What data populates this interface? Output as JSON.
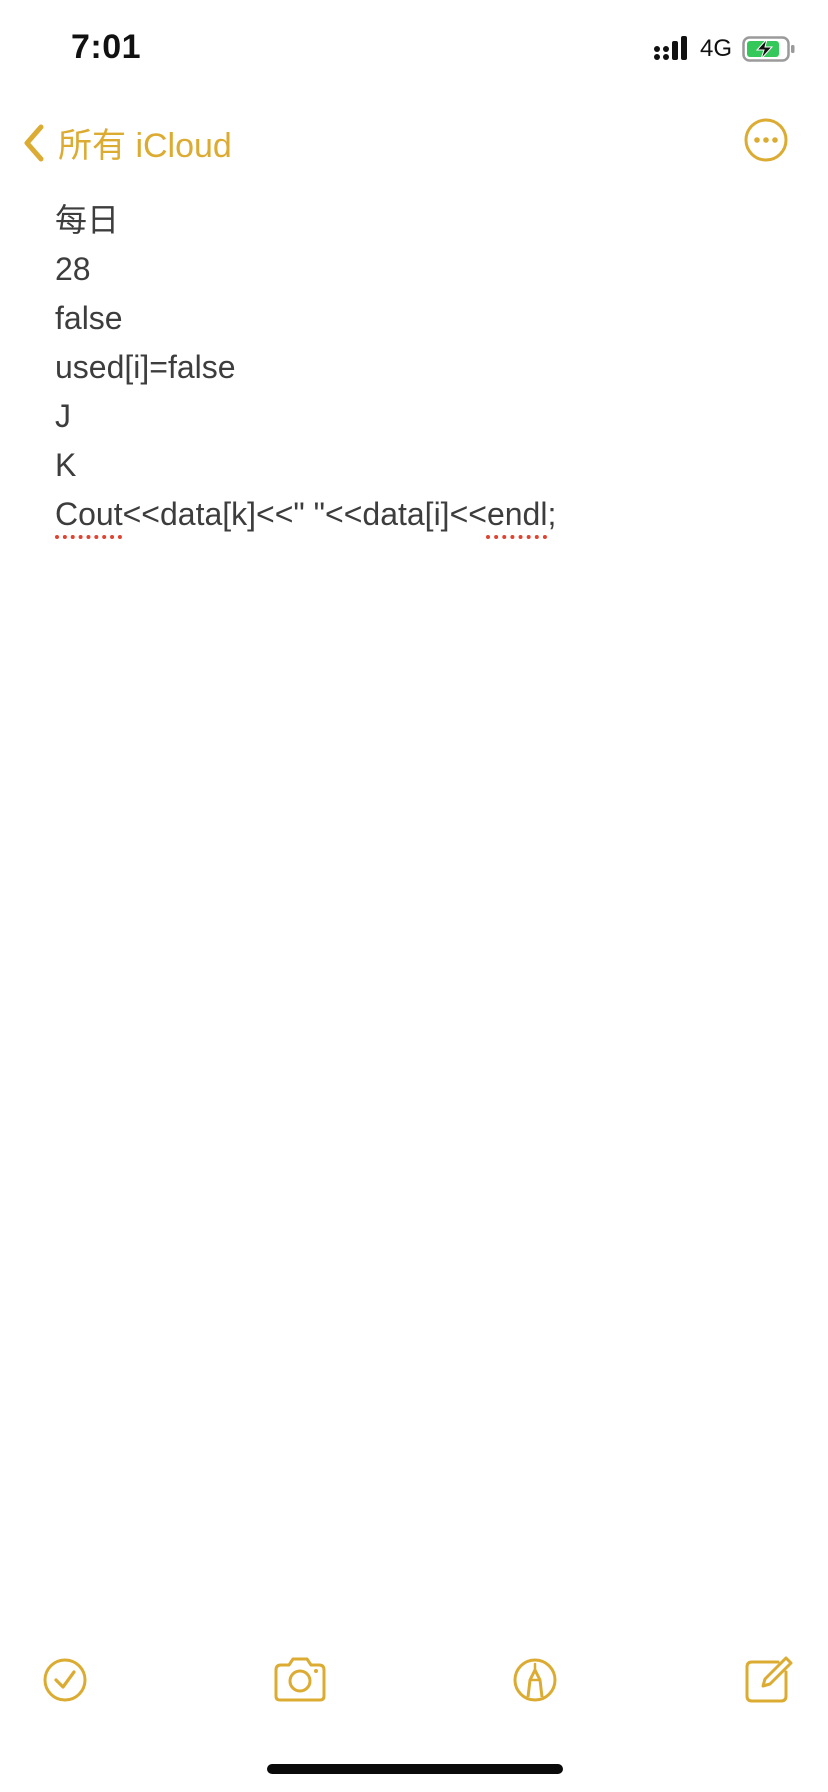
{
  "status_bar": {
    "time": "7:01",
    "network": "4G",
    "signal_icon": "cellular-signal-icon",
    "battery_icon": "battery-charging-icon",
    "battery_color": "#34c759"
  },
  "nav": {
    "back_label": "所有 iCloud",
    "back_icon": "chevron-left-icon",
    "more_icon": "ellipsis-circle-icon",
    "accent_color": "#dcab32"
  },
  "note": {
    "lines": [
      "每日",
      "28",
      "false",
      "used[i]=false",
      "J",
      "K"
    ],
    "last_line": {
      "part1": "Cout",
      "part2": "<<data[k]<<\" \"<<data[i]<<",
      "part3": "endl",
      "part4": ";"
    },
    "spellcheck_color": "#e0432f"
  },
  "toolbar": {
    "items": [
      {
        "icon": "checklist-icon"
      },
      {
        "icon": "camera-icon"
      },
      {
        "icon": "markup-pen-icon"
      },
      {
        "icon": "compose-icon"
      }
    ]
  }
}
